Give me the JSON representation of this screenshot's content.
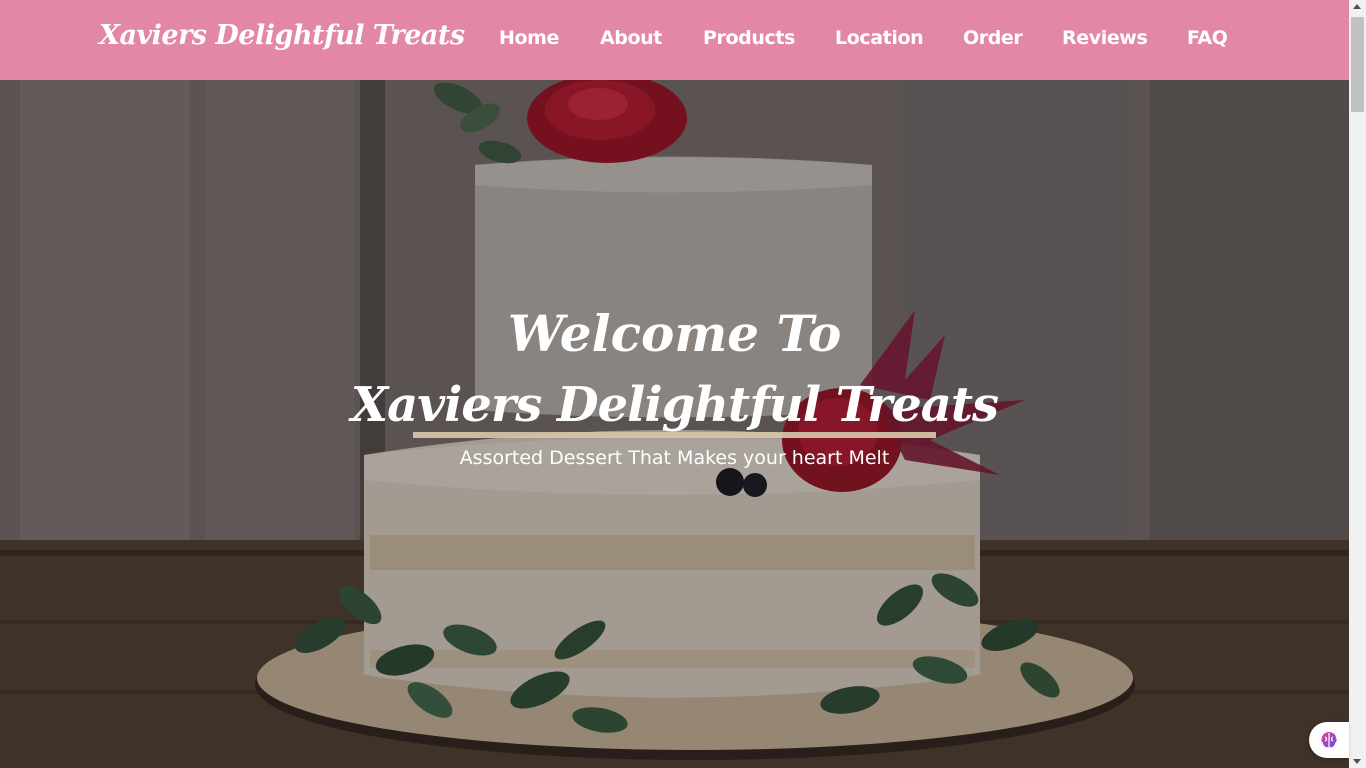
{
  "brand": {
    "name": "Xaviers Delightful Treats",
    "color": "#e387a8"
  },
  "nav": {
    "items": [
      {
        "label": "Home"
      },
      {
        "label": "About"
      },
      {
        "label": "Products"
      },
      {
        "label": "Location"
      },
      {
        "label": "Order"
      },
      {
        "label": "Reviews"
      },
      {
        "label": "FAQ"
      }
    ]
  },
  "hero": {
    "welcome": "Welcome To",
    "title": "Xaviers Delightful Treats",
    "tagline": "Assorted Dessert That Makes your heart Melt",
    "background": "two-tier naked cake with red flowers and eucalyptus leaves",
    "underline_color": "#d6c6a6"
  },
  "widget": {
    "icon": "brain-icon"
  }
}
